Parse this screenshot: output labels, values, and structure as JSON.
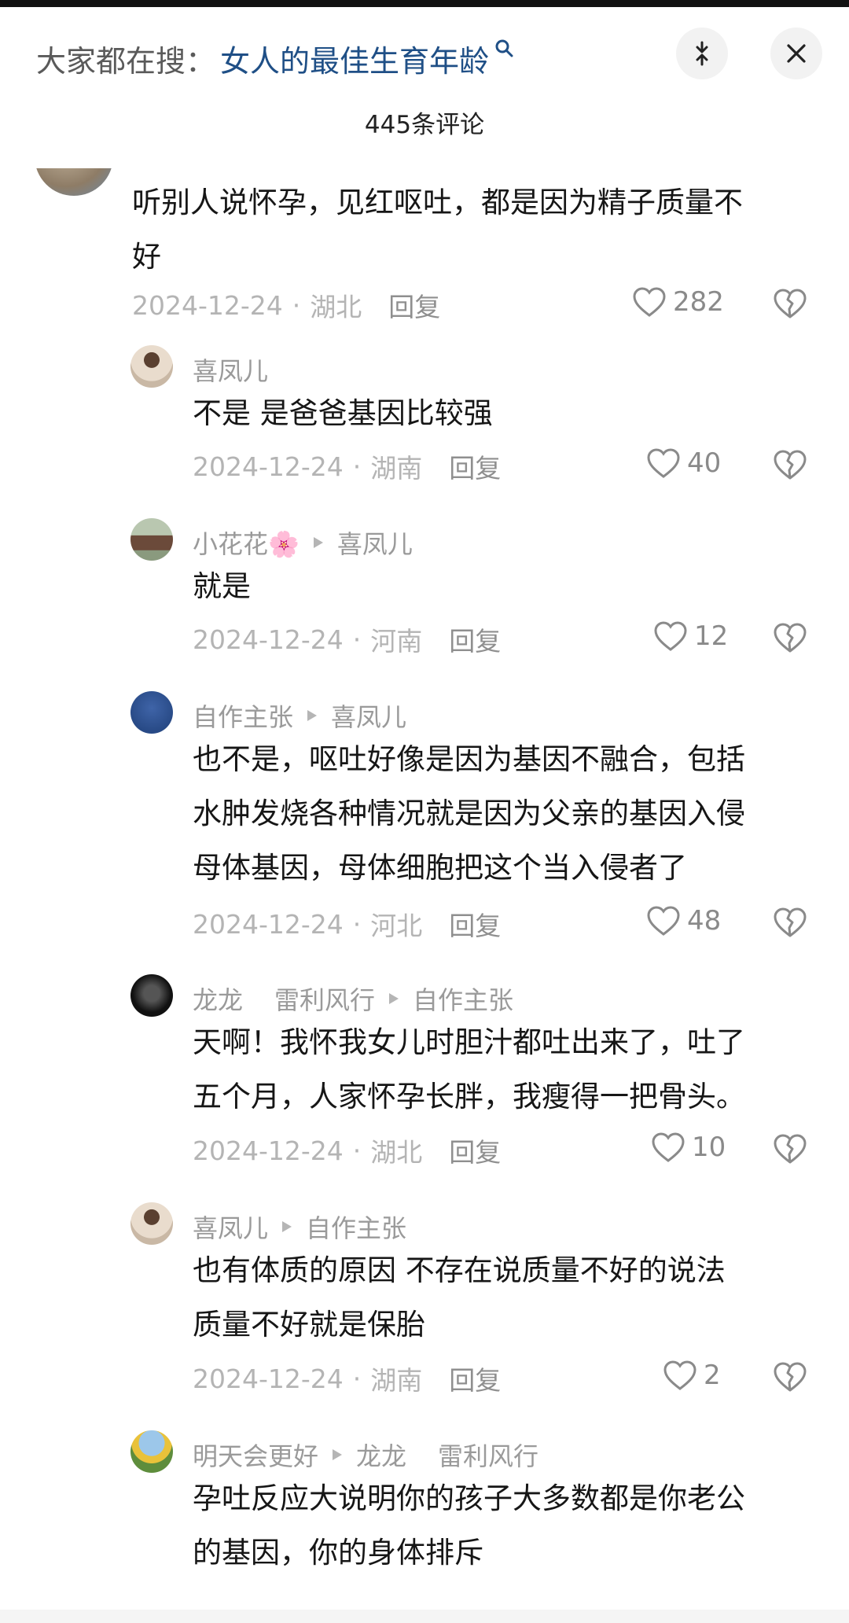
{
  "header": {
    "search_label": "大家都在搜：",
    "search_term": "女人的最佳生育年龄",
    "comment_count": "445条评论"
  },
  "comments": [
    {
      "text": "听别人说怀孕，见红呕吐，都是因为精子质量不\n好",
      "date": "2024-12-24",
      "region": "湖北",
      "reply": "回复",
      "likes": "282"
    },
    {
      "author": "喜凤儿",
      "text": "不是 是爸爸基因比较强",
      "date": "2024-12-24",
      "region": "湖南",
      "reply": "回复",
      "likes": "40"
    },
    {
      "author": "小花花🌸",
      "reply_to": "喜凤儿",
      "text": "就是",
      "date": "2024-12-24",
      "region": "河南",
      "reply": "回复",
      "likes": "12"
    },
    {
      "author": "自作主张",
      "reply_to": "喜凤儿",
      "text": "也不是，呕吐好像是因为基因不融合，包括\n水肿发烧各种情况就是因为父亲的基因入侵\n母体基因，母体细胞把这个当入侵者了",
      "date": "2024-12-24",
      "region": "河北",
      "reply": "回复",
      "likes": "48"
    },
    {
      "author": "龙龙",
      "author2": "雷利风行",
      "reply_to": "自作主张",
      "text": "天啊！我怀我女儿时胆汁都吐出来了，吐了\n五个月，人家怀孕长胖，我瘦得一把骨头。",
      "date": "2024-12-24",
      "region": "湖北",
      "reply": "回复",
      "likes": "10"
    },
    {
      "author": "喜凤儿",
      "reply_to": "自作主张",
      "text": "也有体质的原因 不存在说质量不好的说法\n质量不好就是保胎",
      "date": "2024-12-24",
      "region": "湖南",
      "reply": "回复",
      "likes": "2"
    },
    {
      "author": "明天会更好",
      "reply_to": "龙龙",
      "reply_to2": "雷利风行",
      "text": "孕吐反应大说明你的孩子大多数都是你老公\n的基因，你的身体排斥"
    }
  ],
  "colors": {
    "link_blue": "#1f4f86",
    "meta_gray": "#b4b4b4"
  },
  "icons": [
    "search-icon",
    "collapse-icon",
    "close-icon",
    "heart-icon",
    "broken-heart-icon",
    "play-arrow-icon"
  ]
}
